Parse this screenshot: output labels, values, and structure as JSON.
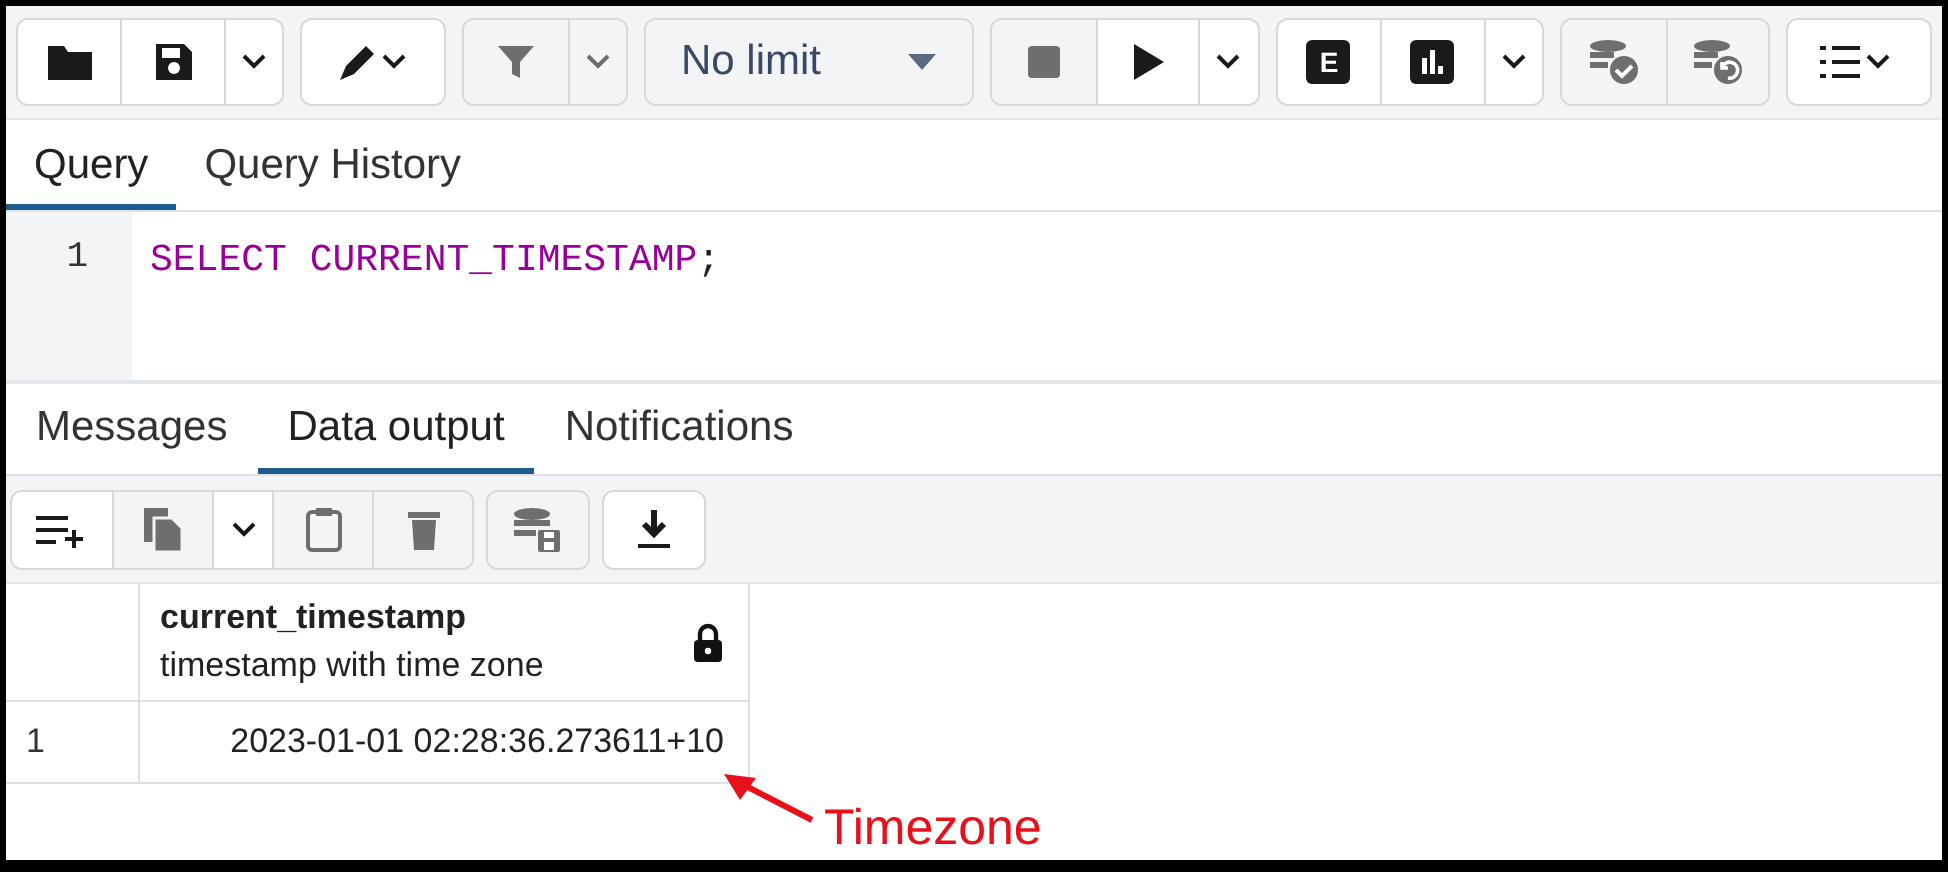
{
  "toolbar": {
    "groups": [
      {
        "buttons": [
          {
            "kind": "open",
            "disabled": false
          },
          {
            "kind": "save",
            "disabled": false
          },
          {
            "kind": "caret",
            "disabled": false
          }
        ]
      },
      {
        "buttons": [
          {
            "kind": "edit",
            "disabled": false
          }
        ]
      },
      {
        "buttons": [
          {
            "kind": "filter",
            "disabled": true
          },
          {
            "kind": "caret",
            "disabled": true
          }
        ]
      },
      {
        "buttons": [
          {
            "kind": "limit",
            "label": "No limit",
            "disabled": true
          }
        ]
      },
      {
        "buttons": [
          {
            "kind": "stop",
            "disabled": true
          },
          {
            "kind": "play",
            "disabled": false
          },
          {
            "kind": "caret",
            "disabled": false
          }
        ]
      },
      {
        "buttons": [
          {
            "kind": "explain",
            "label": "E",
            "disabled": false
          },
          {
            "kind": "analyze",
            "disabled": false
          },
          {
            "kind": "caret",
            "disabled": false
          }
        ]
      },
      {
        "buttons": [
          {
            "kind": "commit",
            "disabled": true
          },
          {
            "kind": "rollback",
            "disabled": true
          }
        ]
      },
      {
        "buttons": [
          {
            "kind": "macros",
            "disabled": false
          }
        ]
      }
    ]
  },
  "editor_tabs": [
    {
      "label": "Query",
      "selected": true
    },
    {
      "label": "Query History",
      "selected": false
    }
  ],
  "editor": {
    "lines": [
      {
        "number": "1",
        "tokens": [
          {
            "text": "SELECT ",
            "kind": "keyword"
          },
          {
            "text": "CURRENT_TIMESTAMP",
            "kind": "keyword"
          },
          {
            "text": ";",
            "kind": "punct"
          }
        ]
      }
    ]
  },
  "result_tabs": [
    {
      "label": "Messages",
      "selected": false
    },
    {
      "label": "Data output",
      "selected": true
    },
    {
      "label": "Notifications",
      "selected": false
    }
  ],
  "data_toolbar": {
    "groups": [
      {
        "buttons": [
          {
            "kind": "add-row",
            "disabled": false
          },
          {
            "kind": "copy",
            "disabled": true
          },
          {
            "kind": "caret",
            "disabled": false
          },
          {
            "kind": "paste",
            "disabled": true
          },
          {
            "kind": "delete",
            "disabled": true
          }
        ]
      },
      {
        "buttons": [
          {
            "kind": "save-data",
            "disabled": true
          }
        ]
      },
      {
        "buttons": [
          {
            "kind": "download",
            "disabled": false
          }
        ]
      }
    ]
  },
  "grid": {
    "columns": [
      {
        "name": "current_timestamp",
        "type": "timestamp with time zone",
        "locked": true
      }
    ],
    "rows": [
      {
        "number": "1",
        "cells": [
          "2023-01-01 02:28:36.273611+10"
        ]
      }
    ]
  },
  "annotation": {
    "text": "Timezone"
  }
}
